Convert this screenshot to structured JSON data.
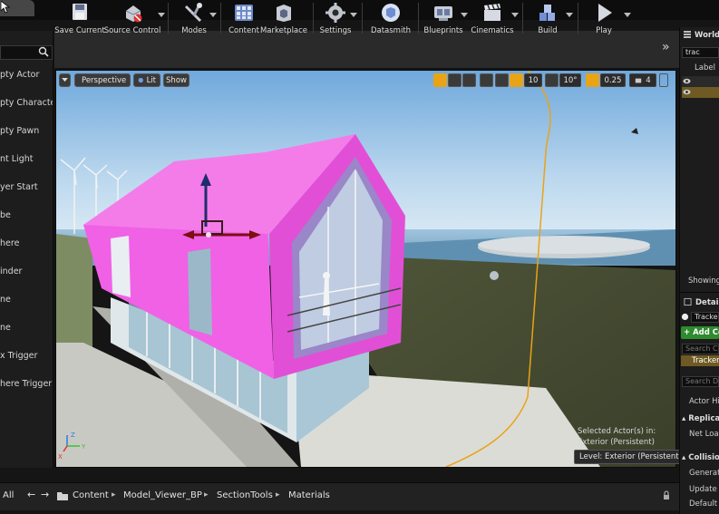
{
  "place_actors": {
    "items": [
      "pty Actor",
      "pty Character",
      "pty Pawn",
      "nt Light",
      "yer Start",
      "be",
      "here",
      "inder",
      "ne",
      "ne",
      "x Trigger",
      "here Trigger"
    ]
  },
  "toolbar": {
    "buttons": [
      "Save Current",
      "Source Control",
      "Modes",
      "Content",
      "Marketplace",
      "Settings",
      "Datasmith",
      "Blueprints",
      "Cinematics",
      "Build",
      "Play"
    ],
    "more": "»"
  },
  "viewport": {
    "view_mode": "Perspective",
    "lit_mode": "Lit",
    "show_label": "Show",
    "grid_snap": "10",
    "rotation_snap": "10°",
    "scale_snap": "0.25",
    "camera_speed": "4",
    "selection_line1": "Selected Actor(s) in:",
    "selection_line2": "Exterior (Persistent)",
    "level_badge": "Level:  Exterior (Persistent)"
  },
  "world_outliner": {
    "title": "World O",
    "search_value": "trac",
    "label_header": "Label",
    "showing": "Showing"
  },
  "details": {
    "title": "Details",
    "actor_name": "Tracker",
    "add_component": "+ Add Co",
    "search_components": "Search Com",
    "component_row": "Tracker",
    "search_details": "Search Det",
    "actor_hidden": "Actor Hidd",
    "section_replication": "Replicati",
    "net_load": "Net Load o",
    "section_collision": "Collision",
    "generate": "Generate O",
    "update": "Update Ov",
    "default": "Default Up"
  },
  "content_browser": {
    "filter_label": "All",
    "path": [
      "Content",
      "Model_Viewer_BP",
      "SectionTools",
      "Materials"
    ]
  },
  "colors": {
    "accent_orange": "#e8a317",
    "selection_magenta": "#f061e6",
    "panel_dark": "#1d1d1d",
    "toolbar_bg": "#2a2a2a"
  }
}
